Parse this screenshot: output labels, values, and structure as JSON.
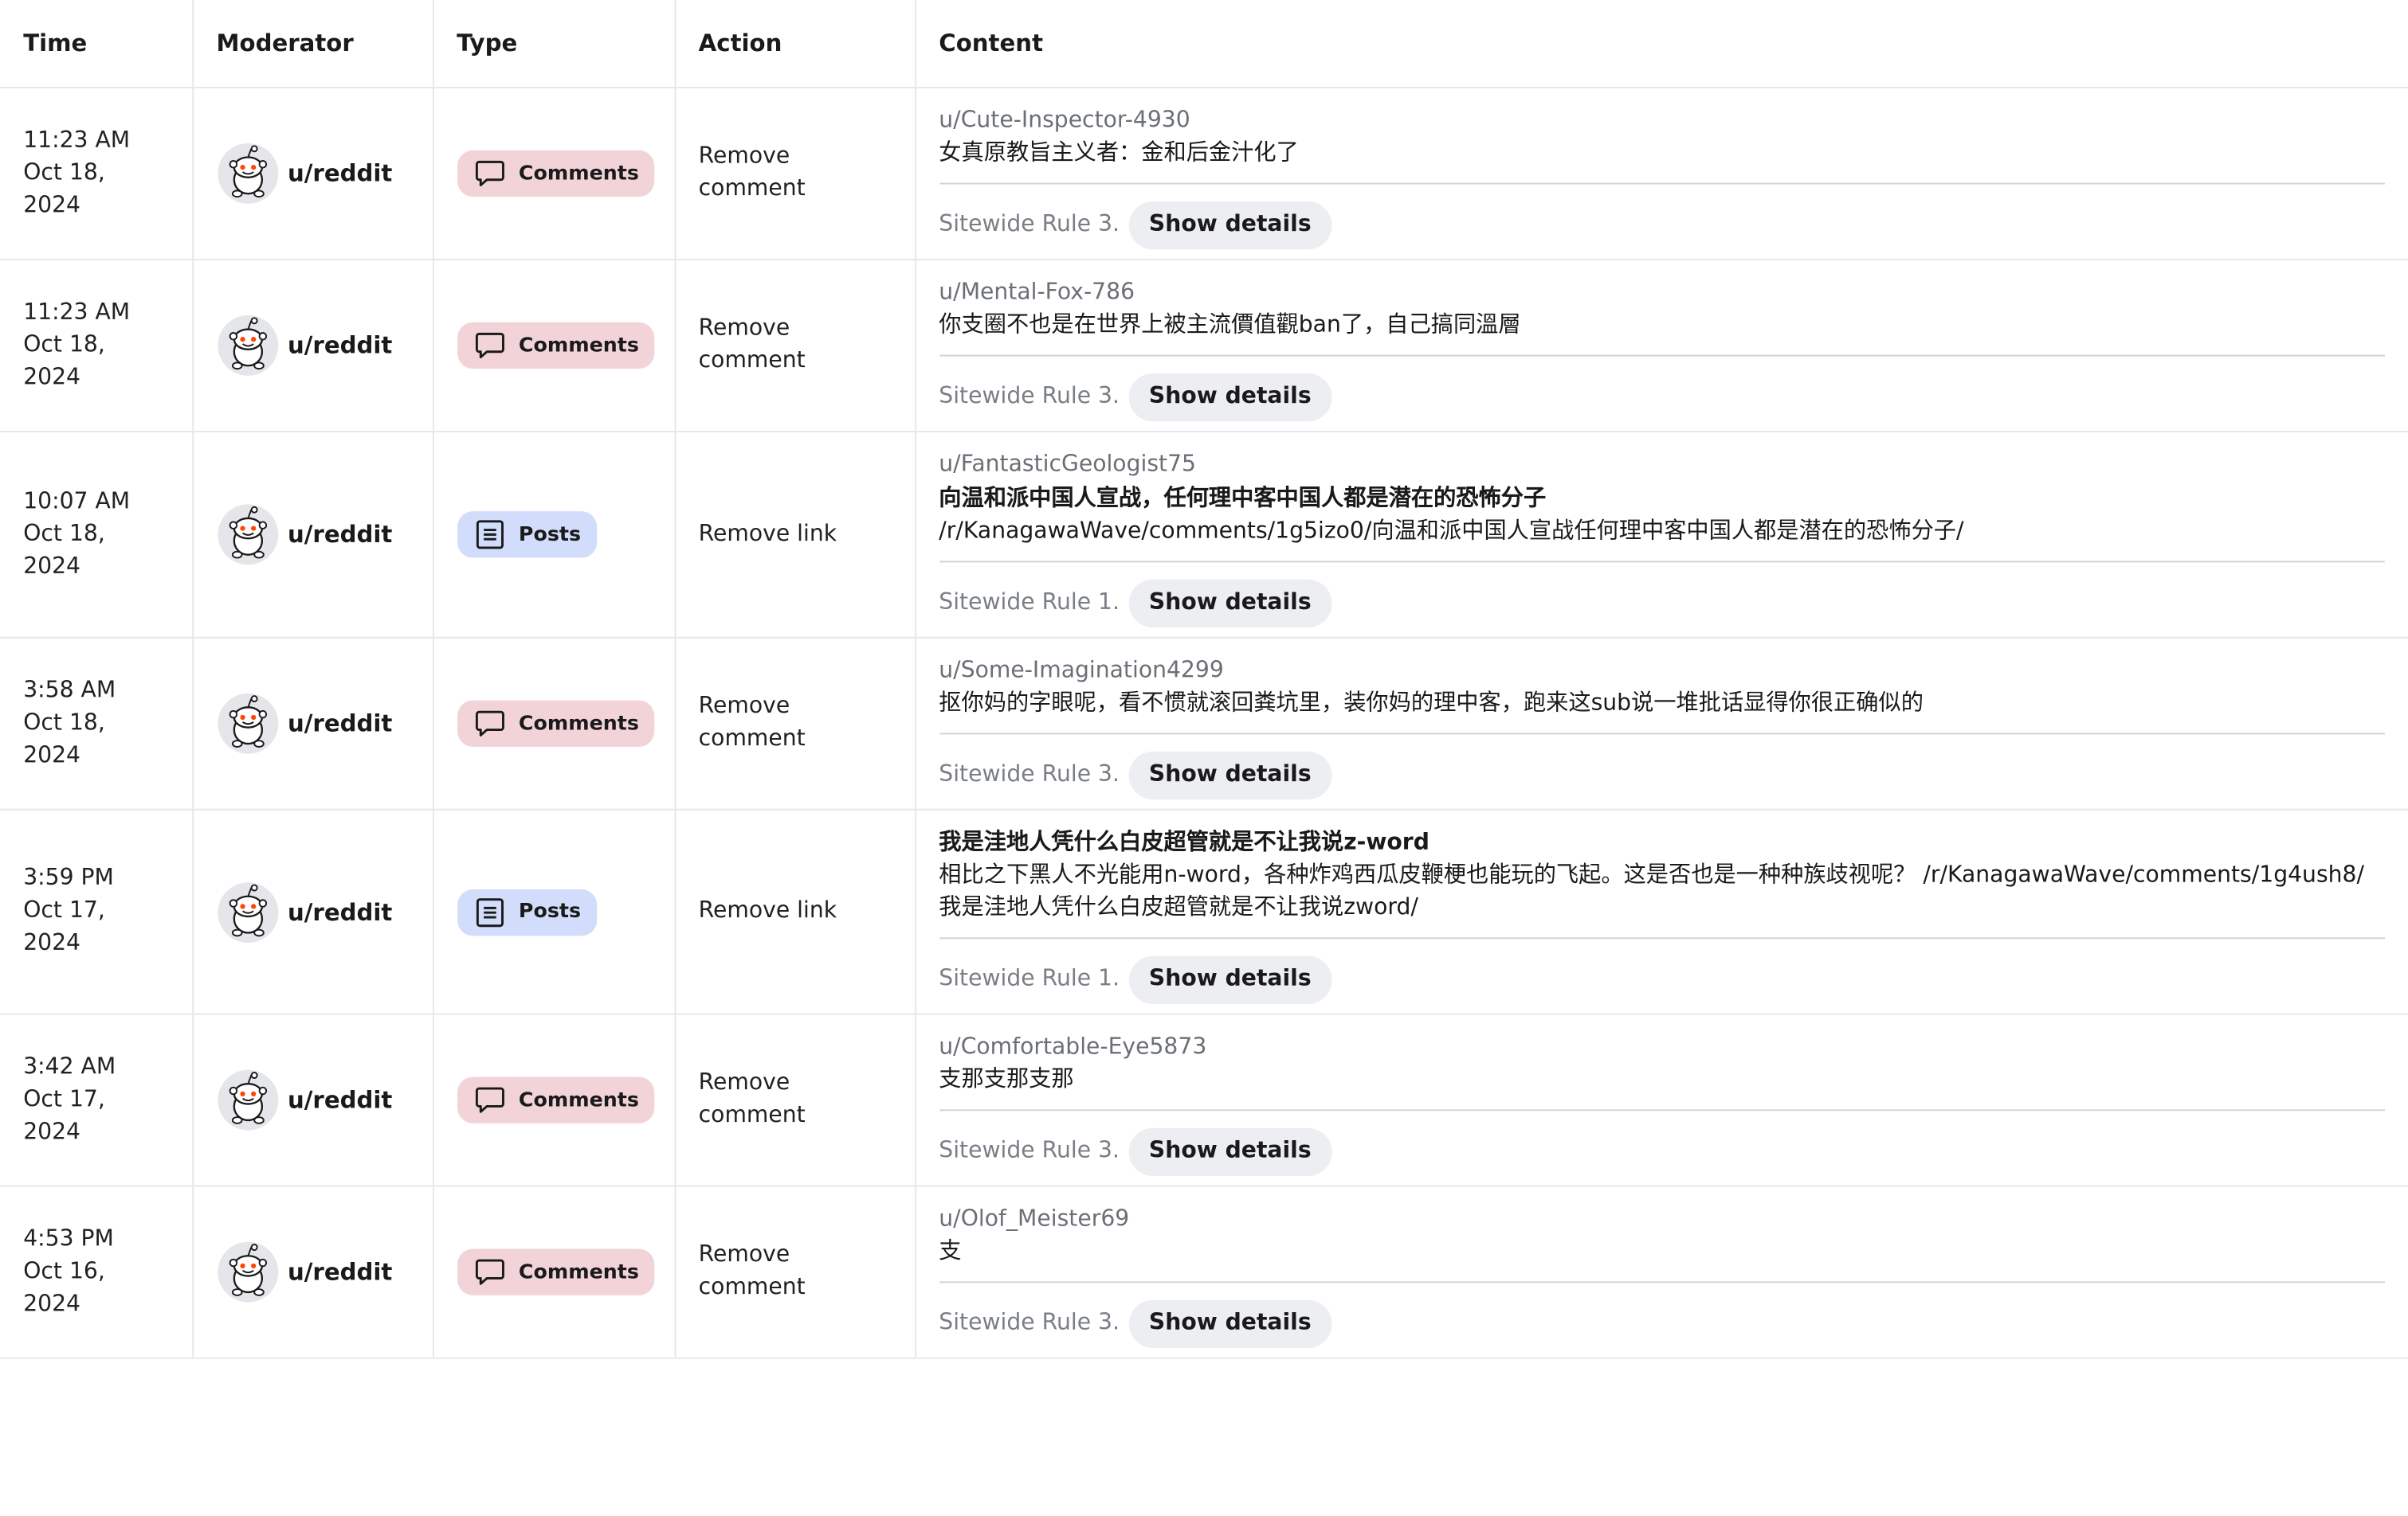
{
  "headers": {
    "time": "Time",
    "moderator": "Moderator",
    "type": "Type",
    "action": "Action",
    "content": "Content"
  },
  "icons": {
    "avatar": "reddit-snoo-avatar-icon",
    "comments": "speech-bubble-icon",
    "posts": "post-list-icon"
  },
  "colors": {
    "comments_badge_bg": "#f2d4d8",
    "posts_badge_bg": "#d2ddfb",
    "details_button_bg": "#eceef1"
  },
  "rows": [
    {
      "time": "11:23 AM",
      "date": "Oct 18, 2024",
      "moderator": "u/reddit",
      "type": "Comments",
      "action": "Remove comment",
      "author": "u/Cute-Inspector-4930",
      "title": "",
      "text": "女真原教旨主义者：金和后金汁化了",
      "rule": "Sitewide Rule 3.",
      "details": "Show details"
    },
    {
      "time": "11:23 AM",
      "date": "Oct 18, 2024",
      "moderator": "u/reddit",
      "type": "Comments",
      "action": "Remove comment",
      "author": "u/Mental-Fox-786",
      "title": "",
      "text": "你支圈不也是在世界上被主流價值觀ban了，自己搞同溫層",
      "rule": "Sitewide Rule 3.",
      "details": "Show details"
    },
    {
      "time": "10:07 AM",
      "date": "Oct 18, 2024",
      "moderator": "u/reddit",
      "type": "Posts",
      "action": "Remove link",
      "author": "u/FantasticGeologist75",
      "title": "向温和派中国人宣战，任何理中客中国人都是潜在的恐怖分子",
      "text": "/r/KanagawaWave/comments/1g5izo0/向温和派中国人宣战任何理中客中国人都是潜在的恐怖分子/",
      "rule": "Sitewide Rule 1.",
      "details": "Show details"
    },
    {
      "time": "3:58 AM",
      "date": "Oct 18, 2024",
      "moderator": "u/reddit",
      "type": "Comments",
      "action": "Remove comment",
      "author": "u/Some-Imagination4299",
      "title": "",
      "text": "抠你妈的字眼呢，看不惯就滚回粪坑里，装你妈的理中客，跑来这sub说一堆批话显得你很正确似的",
      "rule": "Sitewide Rule 3.",
      "details": "Show details"
    },
    {
      "time": "3:59 PM",
      "date": "Oct 17, 2024",
      "moderator": "u/reddit",
      "type": "Posts",
      "action": "Remove link",
      "author": "",
      "title": "我是洼地人凭什么白皮超管就是不让我说z-word",
      "text": "相比之下黑人不光能用n-word，各种炸鸡西瓜皮鞭梗也能玩的飞起。这是否也是一种种族歧视呢？ /r/KanagawaWave/comments/1g4ush8/我是洼地人凭什么白皮超管就是不让我说zword/",
      "rule": "Sitewide Rule 1.",
      "details": "Show details"
    },
    {
      "time": "3:42 AM",
      "date": "Oct 17, 2024",
      "moderator": "u/reddit",
      "type": "Comments",
      "action": "Remove comment",
      "author": "u/Comfortable-Eye5873",
      "title": "",
      "text": "支那支那支那",
      "rule": "Sitewide Rule 3.",
      "details": "Show details"
    },
    {
      "time": "4:53 PM",
      "date": "Oct 16, 2024",
      "moderator": "u/reddit",
      "type": "Comments",
      "action": "Remove comment",
      "author": "u/Olof_Meister69",
      "title": "",
      "text": "支",
      "rule": "Sitewide Rule 3.",
      "details": "Show details"
    }
  ]
}
